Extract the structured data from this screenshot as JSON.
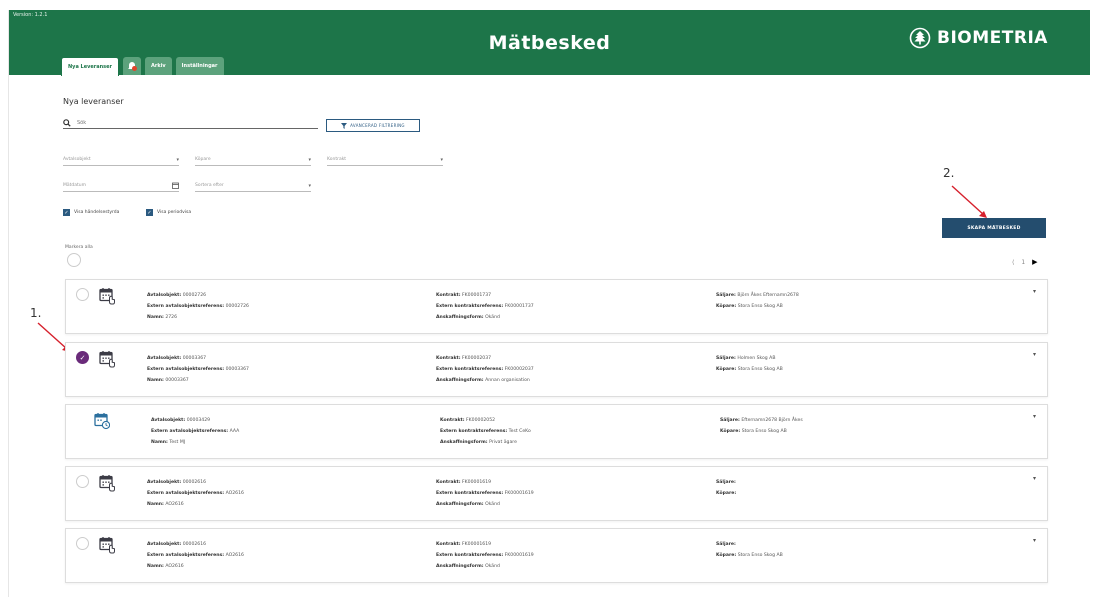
{
  "version": "Version: 1.2.1",
  "app_title": "Mätbesked",
  "logo_text": "BIOMETRIA",
  "tabs": [
    {
      "label": "Nya Leveranser",
      "active": true
    },
    {
      "label": "",
      "icon": "notification-icon"
    },
    {
      "label": "Arkiv"
    },
    {
      "label": "Inställningar"
    }
  ],
  "page": {
    "section_title": "Nya leveranser",
    "search_placeholder": "Sök",
    "advanced_filter_label": "AVANCERAD FILTRERING",
    "filters": {
      "avtalsobjekt": "Avtalsobjekt",
      "kopare": "Köpare",
      "kontrakt": "Kontrakt",
      "matdatum": "Mätdatum",
      "sortera": "Sortera efter"
    },
    "checkbox_events": "Visa händelsestyrda",
    "checkbox_periodic": "Visa periodvisa",
    "create_button": "SKAPA MÄTBESKED",
    "select_all": "Markera alla",
    "annotation_1": "1.",
    "annotation_2": "2.",
    "pagination_prev": "⟨",
    "pagination_page": "1",
    "pagination_next": "▶"
  },
  "labels": {
    "avtalsobjekt": "Avtalsobjekt:",
    "extern_avtal": "Extern avtalsobjektsreferens:",
    "namn": "Namn:",
    "kontrakt": "Kontrakt:",
    "extern_kontrakt": "Extern kontraktsreferens:",
    "anskaffning": "Anskaffningsform:",
    "saljare": "Säljare:",
    "kopare": "Köpare:"
  },
  "colors": {
    "header_green": "#1d7549",
    "button_blue": "#244d6e",
    "checked_purple": "#6a2b7a"
  },
  "deliveries": [
    {
      "avtalsobjekt": "00002726",
      "extern_avtal": "00002726",
      "namn": "2726",
      "kontrakt": "FK00001737",
      "extern_kontrakt": "FK00001737",
      "anskaffning": "Okänd",
      "saljare": "Björn Åkes Efternamn2678",
      "kopare": "Stora Enso Skog AB",
      "selectable": true,
      "checked": false
    },
    {
      "avtalsobjekt": "00003367",
      "extern_avtal": "00003367",
      "namn": "00003367",
      "kontrakt": "FK00002037",
      "extern_kontrakt": "FK00002037",
      "anskaffning": "Annan organisation",
      "saljare": "Holmen Skog AB",
      "kopare": "Stora Enso Skog AB",
      "selectable": true,
      "checked": true
    },
    {
      "avtalsobjekt": "00003429",
      "extern_avtal": "AAA",
      "namn": "Test MJ",
      "kontrakt": "FK00002052",
      "extern_kontrakt": "Test CeKo",
      "anskaffning": "Privat ägare",
      "saljare": "Efternamn2678 Björn Åkes",
      "kopare": "Stora Enso Skog AB",
      "selectable": false,
      "checked": false
    },
    {
      "avtalsobjekt": "00002616",
      "extern_avtal": "AO2616",
      "namn": "AO2616",
      "kontrakt": "FK00001619",
      "extern_kontrakt": "FK00001619",
      "anskaffning": "Okänd",
      "saljare": "",
      "kopare": "",
      "selectable": true,
      "checked": false
    },
    {
      "avtalsobjekt": "00002616",
      "extern_avtal": "AO2616",
      "namn": "AO2616",
      "kontrakt": "FK00001619",
      "extern_kontrakt": "FK00001619",
      "anskaffning": "Okänd",
      "saljare": "",
      "kopare": "Stora Enso Skog AB",
      "selectable": true,
      "checked": false
    }
  ]
}
